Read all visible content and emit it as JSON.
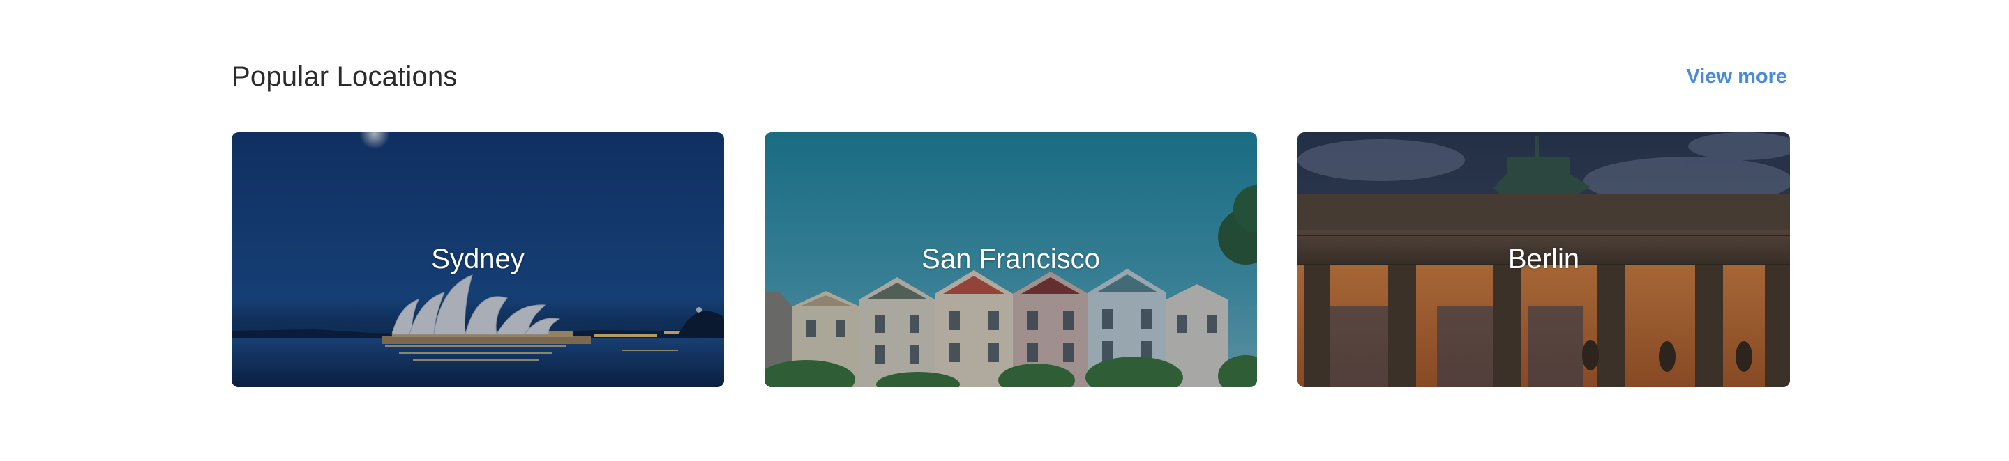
{
  "section": {
    "title": "Popular Locations",
    "view_more_label": "View more"
  },
  "cards": [
    {
      "label": "Sydney",
      "image": "sydney-opera-house-night"
    },
    {
      "label": "San Francisco",
      "image": "painted-ladies-houses"
    },
    {
      "label": "Berlin",
      "image": "brandenburg-gate"
    }
  ],
  "colors": {
    "accent": "#4a8ad8",
    "title_text": "#2b2b2b",
    "card_label": "#ffffff"
  }
}
